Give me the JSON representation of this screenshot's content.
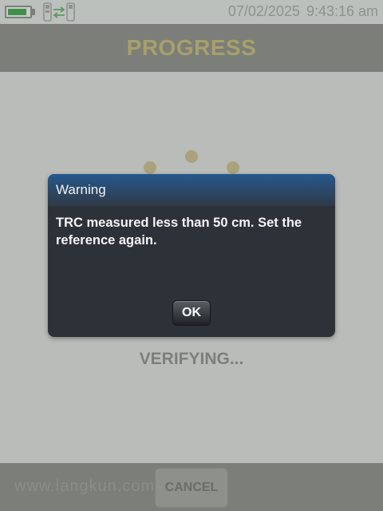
{
  "status_bar": {
    "date": "07/02/2025",
    "time": "9:43:16 am",
    "battery_level": 0.9,
    "battery_icon": "battery-icon",
    "connection_icon": "device-transfer-icon"
  },
  "header": {
    "title": "PROGRESS"
  },
  "main": {
    "status_text": "VERIFYING...",
    "spinner_icon": "loading-dots-icon"
  },
  "dialog": {
    "title": "Warning",
    "message": "TRC measured less than 50 cm. Set the reference again.",
    "ok_label": "OK"
  },
  "footer": {
    "cancel_label": "CANCEL",
    "watermark": "www.langkun.com"
  },
  "colors": {
    "header_bg": "#7b7e79",
    "title_accent": "#a8a06a",
    "dialog_bg": "#2d3138",
    "dialog_titlebar": "#24588e",
    "battery_green": "#3f8f4a"
  }
}
